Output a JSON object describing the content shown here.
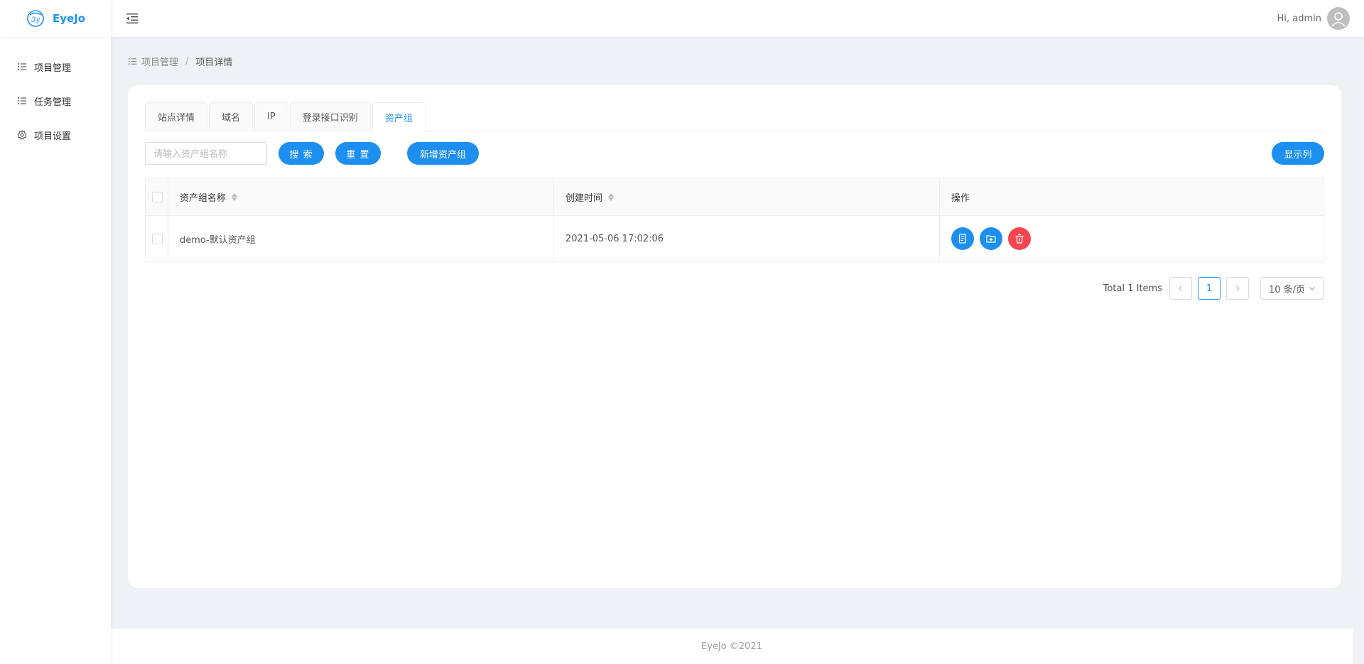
{
  "app": {
    "name": "EyeJo",
    "logo_text": "3y",
    "footer": "EyeJo ©2021"
  },
  "header": {
    "greeting": "Hi, admin"
  },
  "sidebar": {
    "items": [
      {
        "label": "项目管理",
        "icon": "list-icon"
      },
      {
        "label": "任务管理",
        "icon": "list-icon"
      },
      {
        "label": "项目设置",
        "icon": "gear-icon"
      }
    ]
  },
  "breadcrumb": {
    "parent": "项目管理",
    "current": "项目详情"
  },
  "tabs": [
    {
      "label": "站点详情",
      "active": false
    },
    {
      "label": "域名",
      "active": false
    },
    {
      "label": "IP",
      "active": false
    },
    {
      "label": "登录接口识别",
      "active": false
    },
    {
      "label": "资产组",
      "active": true
    }
  ],
  "toolbar": {
    "search_placeholder": "请输入资产组名称",
    "search_label": "搜 索",
    "reset_label": "重 置",
    "add_label": "新增资产组",
    "columns_label": "显示列"
  },
  "table": {
    "columns": [
      "资产组名称",
      "创建时间",
      "操作"
    ],
    "rows": [
      {
        "name": "demo-默认资产组",
        "created": "2021-05-06 17:02:06"
      }
    ]
  },
  "pagination": {
    "total_text": "Total 1 Items",
    "current_page": "1",
    "page_size": "10 条/页"
  },
  "colors": {
    "primary": "#1d8ff0",
    "danger": "#f5464f",
    "background": "#eff1f5"
  }
}
